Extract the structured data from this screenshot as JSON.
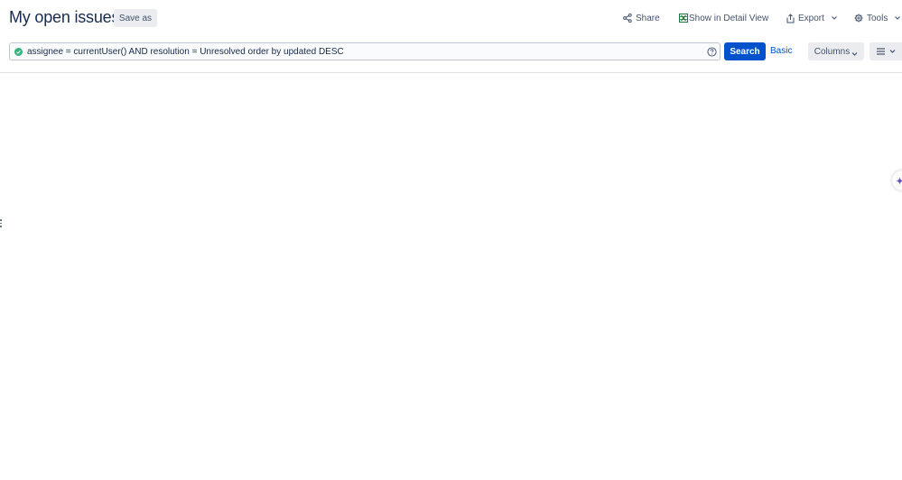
{
  "header": {
    "title": "My open issues",
    "save_as_label": "Save as",
    "share_label": "Share",
    "detail_view_label": "Show in Detail View",
    "export_label": "Export",
    "tools_label": "Tools"
  },
  "search": {
    "jql_value": "assignee = currentUser() AND resolution = Unresolved order by updated DESC",
    "search_label": "Search",
    "basic_label": "Basic",
    "columns_label": "Columns"
  },
  "icons": {
    "share": "share-icon",
    "detail_view": "excel-sheet-icon",
    "export": "export-icon",
    "tools": "gear-icon",
    "valid": "check-circle-icon",
    "help": "question-circle-icon",
    "view": "list-view-icon",
    "ai": "sparkle-icon"
  },
  "colors": {
    "primary": "#0052cc",
    "valid_green": "#36b37e",
    "sheet_green": "#1d7a3a",
    "ai_purple": "#6554c0"
  }
}
